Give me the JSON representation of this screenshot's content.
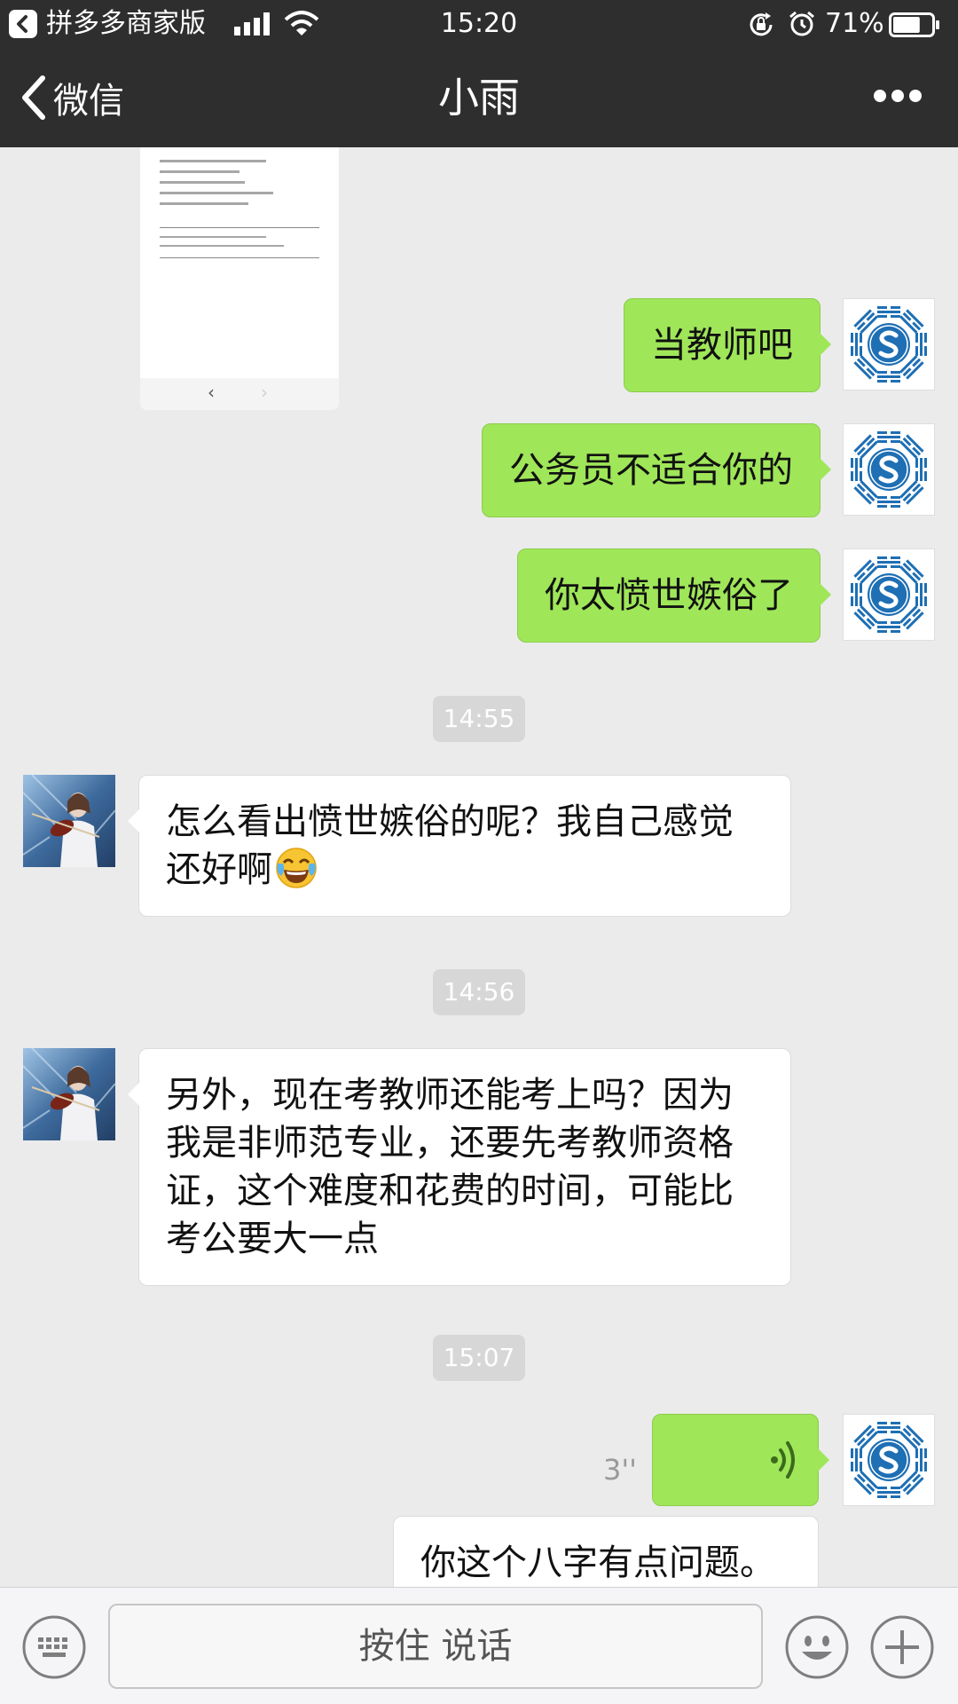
{
  "status_bar": {
    "app_name": "拼多多商家版",
    "time": "15:20",
    "battery_percent": "71%",
    "battery_level": 0.71,
    "icons": [
      "back-to-app-icon",
      "signal-icon",
      "wifi-icon",
      "rotation-lock-icon",
      "alarm-icon",
      "battery-icon"
    ]
  },
  "nav": {
    "back_label": "微信",
    "title": "小雨",
    "more_icon": "more-dots-icon"
  },
  "chat": {
    "messages": [
      {
        "from": "me",
        "text": "当教师吧"
      },
      {
        "from": "me",
        "text": "公务员不适合你的"
      },
      {
        "from": "me",
        "text": "你太愤世嫉俗了"
      },
      {
        "type": "time",
        "text": "14:55"
      },
      {
        "from": "her",
        "text": "怎么看出愤世嫉俗的呢？我自己感觉还好啊",
        "emoji": "tears-of-joy-emoji"
      },
      {
        "type": "time",
        "text": "14:56"
      },
      {
        "from": "her",
        "text": "另外，现在考教师还能考上吗？因为我是非师范专业，还要先考教师资格证，这个难度和花费的时间，可能比考公要大一点"
      },
      {
        "type": "time",
        "text": "15:07"
      },
      {
        "from": "me",
        "type": "voice",
        "duration": "3''"
      },
      {
        "from": "me",
        "text": "你这个八字有点问题。"
      }
    ]
  },
  "input_bar": {
    "hold_to_talk_label": "按住 说话",
    "icons": [
      "keyboard-icon",
      "emoji-icon",
      "plus-icon"
    ]
  },
  "colors": {
    "bar_bg": "#2e2e2e",
    "chat_bg": "#ebebeb",
    "outgoing_bubble": "#9fe659",
    "incoming_bubble": "#ffffff",
    "avatar_blue": "#1e6fb4"
  }
}
